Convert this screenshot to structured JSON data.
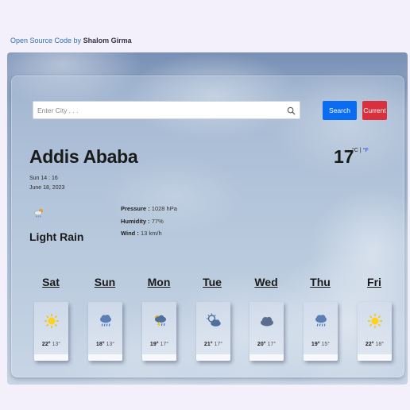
{
  "credit": {
    "prefix": "Open Source Code by",
    "author": "Shalom Girma"
  },
  "search": {
    "placeholder": "Enter City . . .",
    "value": "",
    "search_label": "Search",
    "current_label": "Current"
  },
  "colors": {
    "search_button": "#0a6cf0",
    "current_button": "#d9303e",
    "fahrenheit_link": "#2244dd"
  },
  "current": {
    "city": "Addis Ababa",
    "time": "Sun 14 : 16",
    "date": "June 18, 2023",
    "temperature": "17",
    "unit_c": "°C",
    "unit_sep": "|",
    "unit_f": "°F",
    "condition_icon": "rain-cloud-sun-icon",
    "condition": "Light Rain",
    "pressure_label": "Pressure :",
    "pressure": "1028 hPa",
    "humidity_label": "Humidity :",
    "humidity": "77%",
    "wind_label": "Wind :",
    "wind": "13 km/h"
  },
  "forecast": [
    {
      "day": "Sat",
      "icon": "sun-icon",
      "high": "22°",
      "low": "13°"
    },
    {
      "day": "Sun",
      "icon": "rain-cloud-icon",
      "high": "18°",
      "low": "13°"
    },
    {
      "day": "Mon",
      "icon": "thunder-rain-icon",
      "high": "19°",
      "low": "17°"
    },
    {
      "day": "Tue",
      "icon": "sun-cloud-icon",
      "high": "21°",
      "low": "17°"
    },
    {
      "day": "Wed",
      "icon": "cloud-icon",
      "high": "20°",
      "low": "17°"
    },
    {
      "day": "Thu",
      "icon": "rain-cloud-icon",
      "high": "19°",
      "low": "15°"
    },
    {
      "day": "Fri",
      "icon": "sun-icon",
      "high": "22°",
      "low": "18°"
    }
  ]
}
